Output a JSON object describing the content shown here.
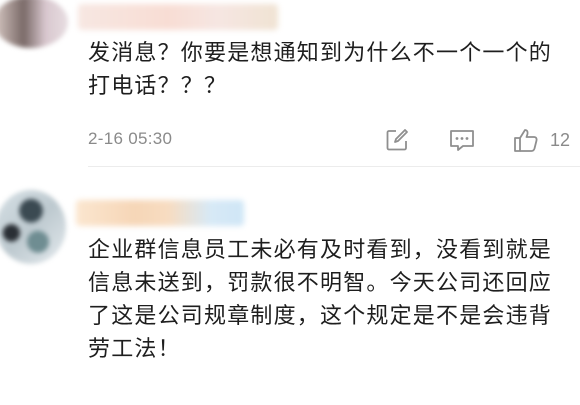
{
  "comments": [
    {
      "text": "发消息？你要是想通知到为什么不一个一个的打电话？？？",
      "timestamp": "2-16 05:30",
      "like_count": "12",
      "actions": {
        "edit_icon": "square-pen-icon",
        "comment_icon": "comment-bubble-icon",
        "like_icon": "thumbs-up-icon"
      }
    },
    {
      "text": "企业群信息员工未必有及时看到，没看到就是信息未送到，罚款很不明智。今天公司还回应了这是公司规章制度，这个规定是不是会违背劳工法！"
    }
  ],
  "colors": {
    "text": "#1e1e1e",
    "meta": "#8a8a8a",
    "divider": "#ececec"
  }
}
